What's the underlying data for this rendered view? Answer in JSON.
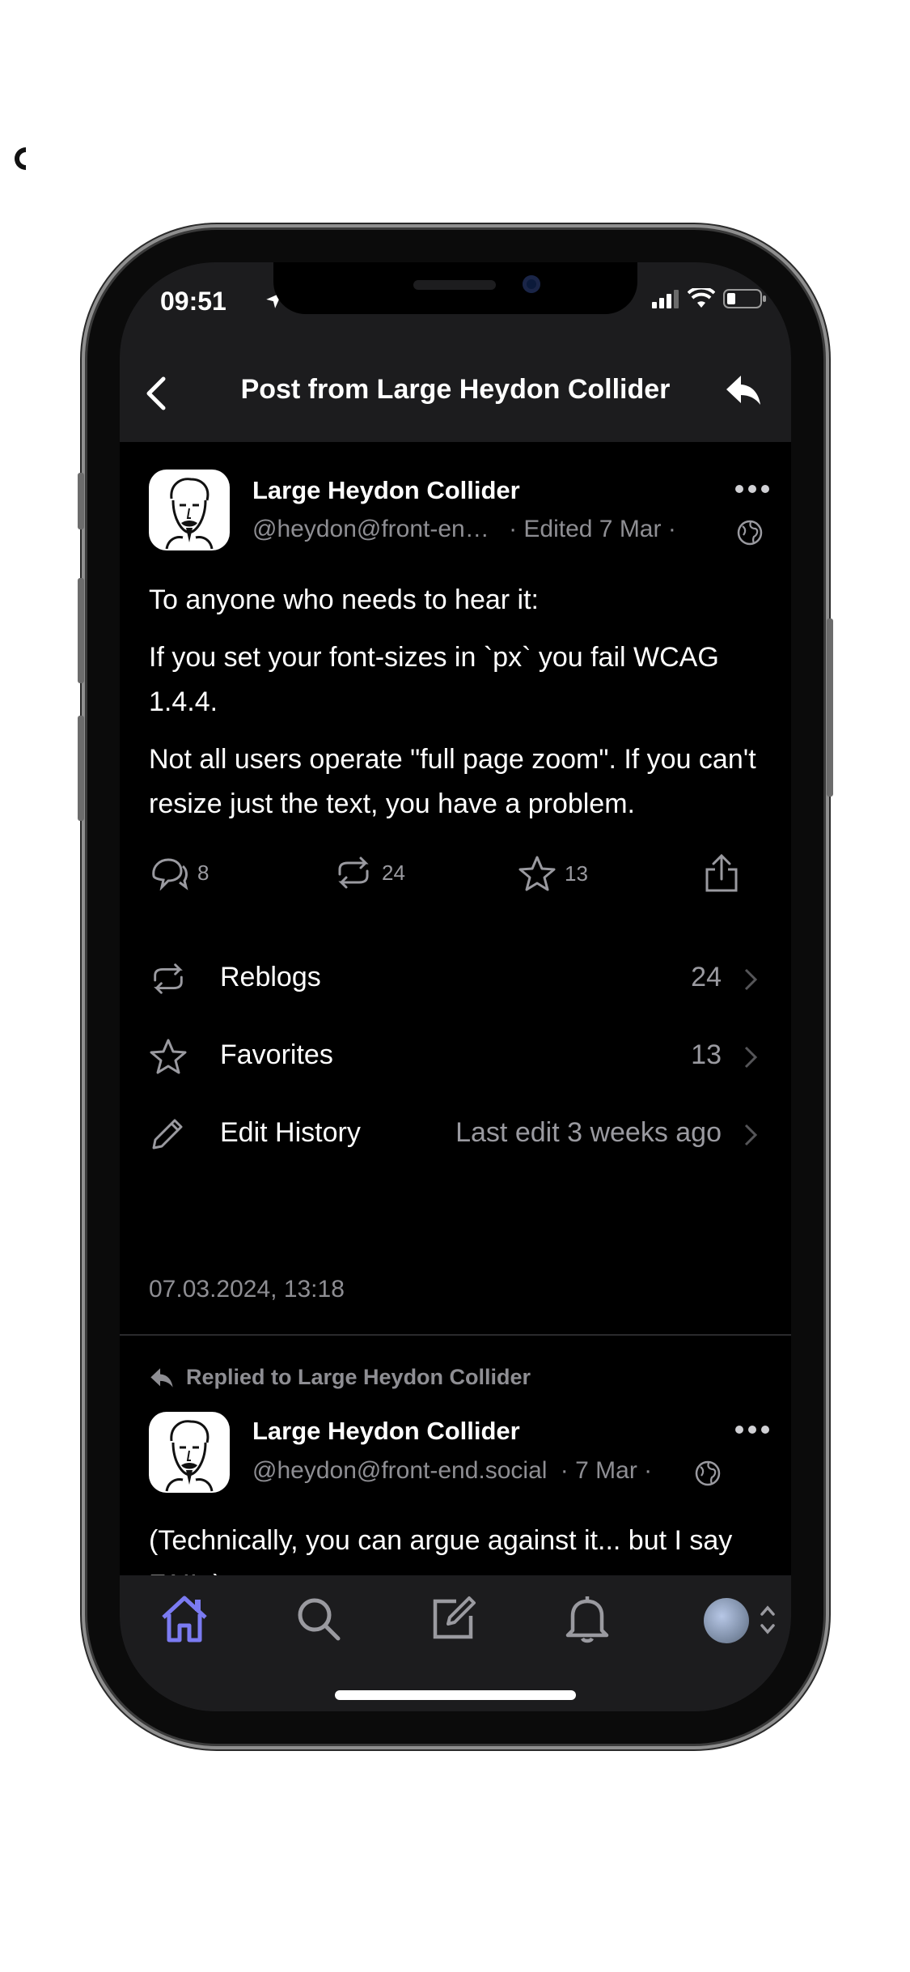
{
  "status_bar": {
    "time": "09:51"
  },
  "nav": {
    "title": "Post from Large Heydon Collider"
  },
  "post": {
    "author_name": "Large Heydon Collider",
    "author_handle": "@heydon@front-en…",
    "meta": "· Edited 7 Mar ·",
    "paragraphs": [
      "To anyone who needs to hear it:",
      "If you set your font-sizes in `px` you fail WCAG 1.4.4.",
      "Not all users operate \"full page zoom\". If you can't resize just the text, you have a problem."
    ],
    "replies_count": "8",
    "reblogs_count": "24",
    "favorites_count": "13"
  },
  "stats": {
    "reblogs_label": "Reblogs",
    "reblogs_value": "24",
    "favorites_label": "Favorites",
    "favorites_value": "13",
    "edit_history_label": "Edit History",
    "edit_history_value": "Last edit 3 weeks ago"
  },
  "post_date": "07.03.2024, 13:18",
  "reply": {
    "context": "Replied to Large Heydon Collider",
    "author_name": "Large Heydon Collider",
    "author_handle": "@heydon@front-end.social",
    "meta": "· 7 Mar ·",
    "text": "(Technically, you can argue against it... but I say FAIL.)"
  },
  "colors": {
    "accent": "#7b7bf2",
    "background": "#000000",
    "bar": "#1c1c1e",
    "secondary_text": "#8e8e93"
  }
}
